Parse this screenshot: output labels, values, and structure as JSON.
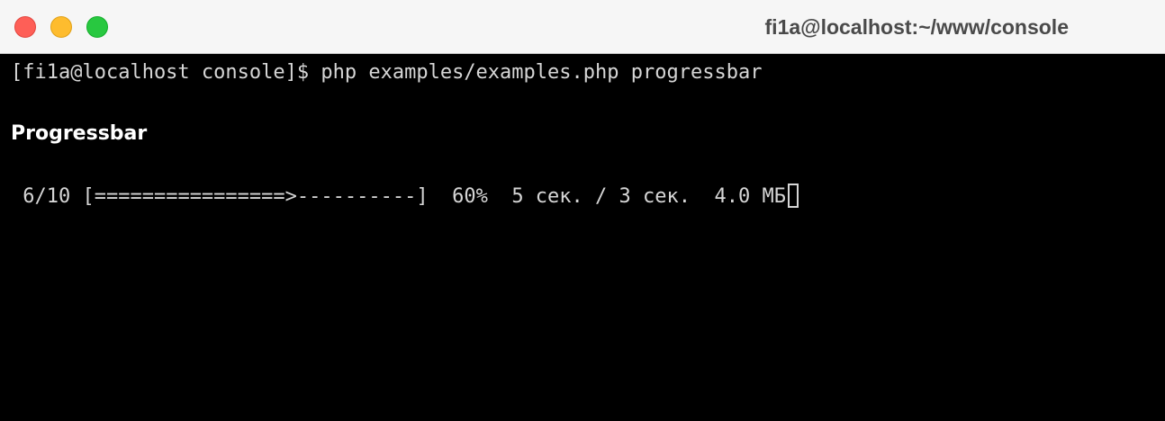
{
  "window": {
    "title": "fi1a@localhost:~/www/console"
  },
  "terminal": {
    "prompt": "[fi1a@localhost console]$ ",
    "command": "php examples/examples.php progressbar",
    "heading": "Progressbar",
    "progress": {
      "count": " 6/10 ",
      "bar": "[================>----------]",
      "percent": "  60%",
      "time": "  5 сек. / 3 сек.",
      "memory": "  4.0 МБ",
      "fraction": 0.6
    }
  },
  "colors": {
    "close": "#fe5f57",
    "minimize": "#febc2e",
    "zoom": "#28c840",
    "terminal_bg": "#000000",
    "terminal_fg": "#d6d6d6"
  }
}
